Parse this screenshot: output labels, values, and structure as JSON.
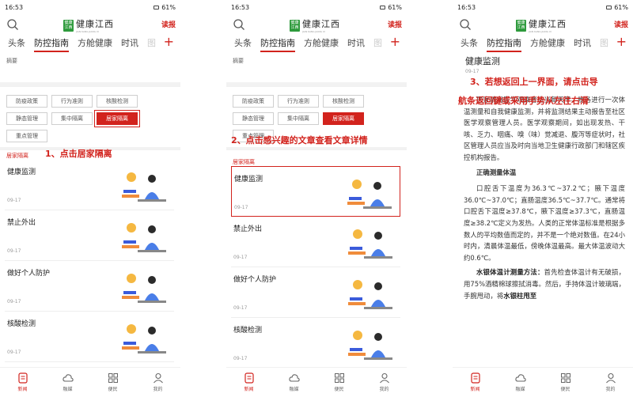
{
  "status": {
    "time": "16:53",
    "battery": "61%"
  },
  "app": {
    "name": "健康江西",
    "badge": "健康江西",
    "pinyin": "JIAN KANG JIANG XI",
    "report": "读报"
  },
  "tabs": [
    {
      "label": "头条",
      "active": false
    },
    {
      "label": "防控指南",
      "active": true
    },
    {
      "label": "方舱健康",
      "active": false
    },
    {
      "label": "时讯",
      "active": false
    },
    {
      "label": "图",
      "active": false
    }
  ],
  "summary_label": "摘要",
  "chips": [
    "防疫政策",
    "行为准则",
    "核酸检测",
    "静态管理",
    "集中隔离",
    "居家隔离",
    "重点管理"
  ],
  "active_chip": "居家隔离",
  "section_label": "居家隔离",
  "articles": [
    {
      "title": "健康监测",
      "date": "09-17"
    },
    {
      "title": "禁止外出",
      "date": "09-17"
    },
    {
      "title": "做好个人防护",
      "date": "09-17"
    },
    {
      "title": "核酸检测",
      "date": "09-17"
    }
  ],
  "bottom_nav": [
    {
      "label": "新闻",
      "icon": "news-icon",
      "active": true
    },
    {
      "label": "融媒",
      "icon": "cloud-icon",
      "active": false
    },
    {
      "label": "便民",
      "icon": "grid-icon",
      "active": false
    },
    {
      "label": "我的",
      "icon": "user-icon",
      "active": false
    }
  ],
  "annotations": {
    "step1": "1、点击居家隔离",
    "step2": "2、点击感兴趣的文章查看文章详情",
    "step3_line1": "3、若想返回上一界面，请点击导",
    "step3_line2": "航条返回键或采用手势从左往右滑"
  },
  "article_detail": {
    "title": "健康监测",
    "date": "09-17",
    "para1": "居家隔离医学观察者应当每天早、晚各进行一次体温测量和自我健康监测，并将监测结果主动报告至社区医学观察管理人员。医学观察期间，如出现发热、干咳、乏力、咽痛、嗅（味）觉减退、腹泻等症状时，社区管理人员应当及时向当地卫生健康行政部门和辖区疾控机构报告。",
    "heading": "正确测量体温",
    "para2": "口腔舌下温度为36.3℃~37.2℃；腋下温度36.0℃~37.0℃；直肠温度36.5℃~37.7℃。通常将口腔舌下温度≥37.8℃，腋下温度≥37.3℃，直肠温度≥38.2℃定义为发热。人类的正常体温标准是根据多数人的平均数值而定的，并不是一个绝对数值。在24小时内，清晨体温最低，傍晚体温最高。最大体温波动大约0.6℃。",
    "para3_bold": "水银体温计测量方法：",
    "para3": "首先检查体温计有无破损，用75%酒精棉球擦拭消毒。然后，手持体温计玻璃端，手腕甩动，将",
    "para3_tail": "水银柱甩至"
  }
}
